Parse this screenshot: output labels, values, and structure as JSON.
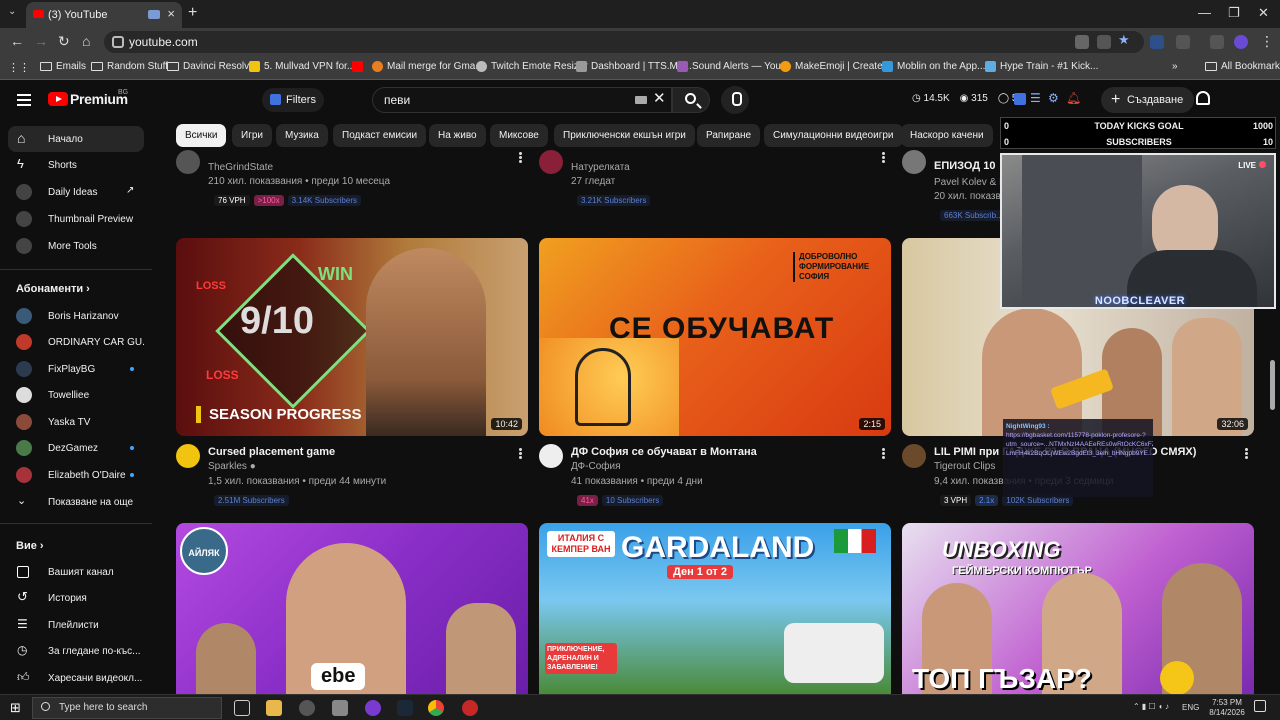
{
  "browser": {
    "tab_title": "(3) YouTube",
    "address": "youtube.com",
    "bookmarks": [
      "Emails",
      "Random Stuff",
      "Davinci Resolve",
      "5. Mullvad VPN for...",
      "Mail merge for Gma...",
      "Twitch Emote Resizer",
      "Dashboard | TTS.Mo...",
      "Sound Alerts — You...",
      "MakeEmoji | Create...",
      "Moblin on the App...",
      "Hype Train - #1 Kick..."
    ],
    "all_bookmarks": "All Bookmarks"
  },
  "header": {
    "logo": "Premium",
    "region": "BG",
    "filters": "Filters",
    "search_value": "певи",
    "stats": [
      "14.5K",
      "315",
      "5"
    ],
    "create": "Създаване",
    "notif_count": "3",
    "avatar": "N"
  },
  "sidebar": {
    "main": [
      {
        "label": "Начало",
        "icon": "home-icon"
      },
      {
        "label": "Shorts",
        "icon": "shorts-icon"
      },
      {
        "label": "Daily Ideas",
        "icon": "ideas-icon"
      },
      {
        "label": "Thumbnail Preview",
        "icon": "thumbnail-icon"
      },
      {
        "label": "More Tools",
        "icon": "tools-icon"
      }
    ],
    "subs_heading": "Абонаменти",
    "subs": [
      {
        "label": "Boris Harizanov",
        "color": "#3a5a7a",
        "dot": false
      },
      {
        "label": "ORDINARY CAR GU...",
        "color": "#c0392b",
        "dot": false
      },
      {
        "label": "FixPlayBG",
        "color": "#2b3b4d",
        "dot": true
      },
      {
        "label": "Towelliee",
        "color": "#dddddd",
        "dot": false
      },
      {
        "label": "Yaska TV",
        "color": "#8a4b3a",
        "dot": false
      },
      {
        "label": "DezGamez",
        "color": "#4a7a4a",
        "dot": true
      },
      {
        "label": "Elizabeth O'Daire",
        "color": "#a8323a",
        "dot": true
      }
    ],
    "show_more": "Показване на още",
    "you_heading": "Вие",
    "you": [
      {
        "label": "Вашият канал",
        "icon": "channel-icon"
      },
      {
        "label": "История",
        "icon": "history-icon"
      },
      {
        "label": "Плейлисти",
        "icon": "playlist-icon"
      },
      {
        "label": "За гледане по-къс...",
        "icon": "watch-later-icon"
      },
      {
        "label": "Харесани видеокл...",
        "icon": "like-icon"
      }
    ]
  },
  "chips": [
    "Всички",
    "Игри",
    "Музика",
    "Подкаст емисии",
    "На живо",
    "Миксове",
    "Приключенски екшън игри",
    "Рапиране",
    "Симулационни видеоигри",
    "Наскоро качени",
    "Гледани",
    "Нови за вас"
  ],
  "top_row": [
    {
      "channel": "TheGrindState",
      "meta": "210 хил. показвания • преди 10 месеца",
      "vph": "76 VPH",
      "mult": ">100x",
      "subs": "3.14K Subscribers"
    },
    {
      "channel": "Натурелката",
      "meta": "27 гледат",
      "subs": "3.21K Subscribers"
    },
    {
      "title": "ЕПИЗОД 10",
      "channel": "Pavel Kolev & Ic...",
      "meta": "20 хил. показвания",
      "subs": "663K Subscrib..."
    }
  ],
  "videos": [
    {
      "title": "Cursed placement game",
      "channel": "Sparkles",
      "meta": "1,5 хил. показвания • преди 44 минути",
      "subs": "2.51M Subscribers",
      "duration": "10:42",
      "thumb_text": "9/10",
      "thumb_sub": "SEASON PROGRESS",
      "thumb_loss": "LOSS",
      "thumb_win": "WIN"
    },
    {
      "title": "ДФ София се обучават в Монтана",
      "channel": "ДФ-София",
      "meta": "41 показвания • преди 4 дни",
      "mult": "41x",
      "subs": "10 Subscribers",
      "duration": "2:15",
      "thumb_text": "СЕ ОБУЧАВАТ",
      "thumb_sub": "ДОБРОВОЛНО ФОРМИРОВАНИЕ СОФИЯ"
    },
    {
      "title": "LIL PIMI при ГАДЖЕ ВЪВ ВРАЦА (МНОГО СМЯХ)",
      "channel": "Tigerout Clips",
      "meta": "9,4 хил. показвания • преди 3 седмици",
      "vph": "3 VPH",
      "mult": "2.1x",
      "subs": "102K Subscribers",
      "duration": "32:06"
    }
  ],
  "bottom_row": [
    {
      "thumb_text": "ebe",
      "thumb_badge": "АЙЛЯК"
    },
    {
      "thumb_text": "GARDALAND",
      "thumb_tag": "ИТАЛИЯ С КЕМПЕР ВАН",
      "thumb_sub": "Ден 1 от 2",
      "thumb_note": "ПРИКЛЮЧЕНИЕ, АДРЕНАЛИН И ЗАБАВЛЕНИЕ!"
    },
    {
      "thumb_text": "UNBOXING",
      "thumb_sub": "ТОП ГЪЗАР?",
      "thumb_note": "ГЕЙМЪРСКИ КОМПЮТЪР"
    }
  ],
  "overlay": {
    "goal_label": "TODAY KICKS GOAL",
    "goal_current": "0",
    "goal_max": "1000",
    "subs_label": "SUBSCRIBERS",
    "subs_current": "0",
    "subs_max": "10",
    "live": "LIVE",
    "cam_name": "NOOBCLEAVER",
    "chat_user": "NightWing93 :",
    "chat_text": "https://bgbasket.com/115778-poklon-profesore-?utm_source=...NTMxNzI4AAEeREs0wRtOcKC6xFZOOyVBunie1KK50T16-LmFH4k2BqOLjWEw2BgdEt3_3elh_bHNgpb9YE..."
  },
  "taskbar": {
    "search": "Type here to search",
    "lang": "ENG",
    "time": "7:53 PM",
    "date": "8/14/2026"
  }
}
